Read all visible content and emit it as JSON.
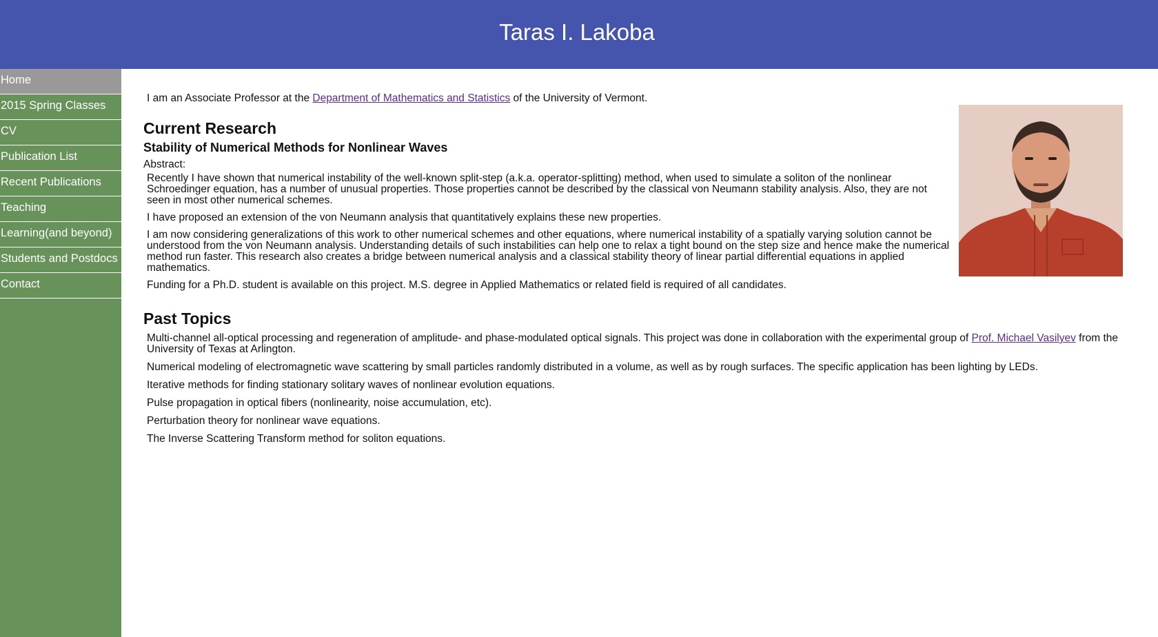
{
  "header": {
    "title": "Taras I. Lakoba"
  },
  "nav": {
    "items": [
      {
        "label": "Home"
      },
      {
        "label": "2015 Spring Classes"
      },
      {
        "label": "CV"
      },
      {
        "label": "Publication List"
      },
      {
        "label": "Recent Publications"
      },
      {
        "label": "Teaching"
      },
      {
        "label": "Learning(and beyond)"
      },
      {
        "label": "Students and Postdocs"
      },
      {
        "label": "Contact"
      }
    ]
  },
  "main": {
    "intro": {
      "before": "I am an Associate Professor at the ",
      "link": "Department of Mathematics and Statistics",
      "after": " of the University of Vermont."
    },
    "research": {
      "heading": "Current Research",
      "subheading": "Stability of Numerical Methods for Nonlinear Waves",
      "abstract_label": "Abstract:",
      "paragraphs": [
        "Recently I have shown that numerical instability of the well-known split-step (a.k.a. operator-splitting) method, when used to simulate a soliton of the nonlinear Schroedinger equation, has a number of unusual properties. Those properties cannot be described by the classical von Neumann stability analysis. Also, they are not seen in most other numerical schemes.",
        "I have proposed an extension of the von Neumann analysis that quantitatively explains these new properties.",
        "I am now considering generalizations of this work to other numerical schemes and other equations, where numerical instability of a spatially varying solution cannot be understood from the von Neumann analysis. Understanding details of such instabilities can help one to relax a tight bound on the step size and hence make the numerical method run faster. This research also creates a bridge between numerical analysis and a classical stability theory of linear partial differential equations in applied mathematics.",
        "Funding for a Ph.D. student is available on this project. M.S. degree in Applied Mathematics or related field is required of all candidates."
      ]
    },
    "past": {
      "heading": "Past Topics",
      "item1_before": "Multi-channel all-optical processing and regeneration of amplitude- and phase-modulated optical signals. This project was done in collaboration with the experimental group of ",
      "item1_link": "Prof. Michael Vasilyev",
      "item1_after": " from the University of Texas at Arlington.",
      "items": [
        "Numerical modeling of electromagnetic wave scattering by small particles randomly distributed in a volume, as well as by rough surfaces. The specific application has been lighting by LEDs.",
        "Iterative methods for finding stationary solitary waves of nonlinear evolution equations.",
        "Pulse propagation in optical fibers (nonlinearity, noise accumulation, etc).",
        "Perturbation theory for nonlinear wave equations.",
        "The Inverse Scattering Transform method for soliton equations."
      ]
    }
  },
  "colors": {
    "header_bg": "#4554ad",
    "sidebar_bg": "#67925a",
    "active_nav_bg": "#999999",
    "link": "#5b2e8a"
  }
}
